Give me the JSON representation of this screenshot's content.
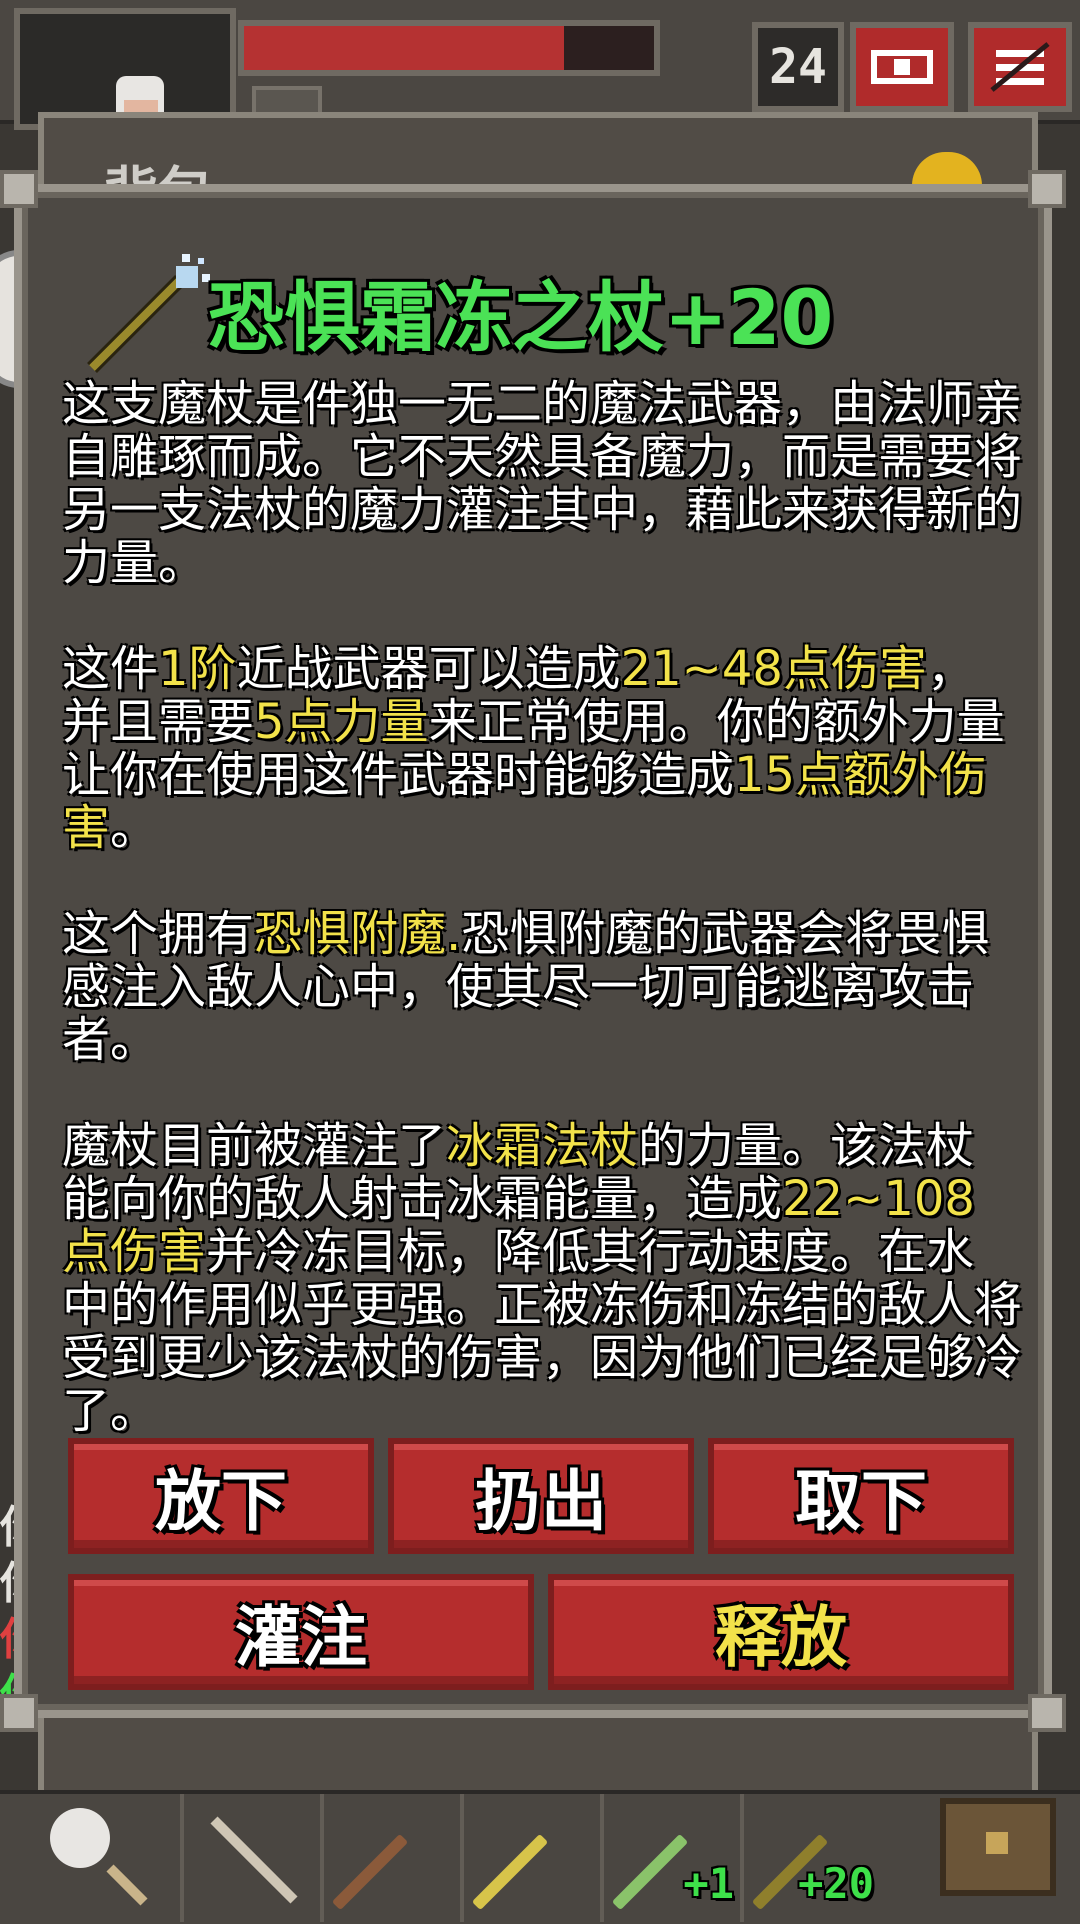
{
  "hud": {
    "depth": "24",
    "hp_fraction": 0.78,
    "journal_icon": "journal-icon",
    "menu_icon": "menu-icon"
  },
  "backpack": {
    "title": "背包"
  },
  "item": {
    "icon": "frost-staff-icon",
    "title": "恐惧霜冻之杖+20",
    "p1": "这支魔杖是件独一无二的魔法武器，由法师亲自雕琢而成。它不天然具备魔力，而是需要将另一支法杖的魔力灌注其中，藉此来获得新的力量。",
    "p2": {
      "t1": "这件",
      "h1": "1阶",
      "t2": "近战武器可以造成",
      "h2": "21~48点伤害",
      "t3": "，并且需要",
      "h3": "5点力量",
      "t4": "来正常使用。你的额外力量让你在使用这件武器时能够造成",
      "h4": "15点额外伤害",
      "t5": "。"
    },
    "p3": {
      "t1": "这个拥有",
      "h1": "恐惧附魔.",
      "t2": "恐惧附魔的武器会将畏惧感注入敌人心中，使其尽一切可能逃离攻击者。"
    },
    "p4": {
      "t1": "魔杖目前被灌注了",
      "h1": "冰霜法杖",
      "t2": "的力量。该法杖能向你的敌人射击冰霜能量，造成",
      "h2": "22~108点伤害",
      "t3": "并冷冻目标，降低其行动速度。在水中的作用似乎更强。正被冻伤和冻结的敌人将受到更少该法杖的伤害，因为他们已经足够冷了。"
    }
  },
  "actions": {
    "drop": "放下",
    "throw": "扔出",
    "unequip": "取下",
    "imbue": "灌注",
    "release": "释放"
  },
  "quickslots": [
    {
      "label": "",
      "icon": "staff-icon",
      "color": "#8b5a3a"
    },
    {
      "label": "",
      "icon": "staff-icon",
      "color": "#d7c44a"
    },
    {
      "label": "+1",
      "icon": "staff-icon",
      "color": "#8ac36a"
    },
    {
      "label": "+20",
      "icon": "frost-staff-icon",
      "color": "#8f7f2c"
    }
  ],
  "colors": {
    "title_green": "#4be256",
    "highlight_yellow": "#f2e24a",
    "button_red": "#b52d2d"
  }
}
